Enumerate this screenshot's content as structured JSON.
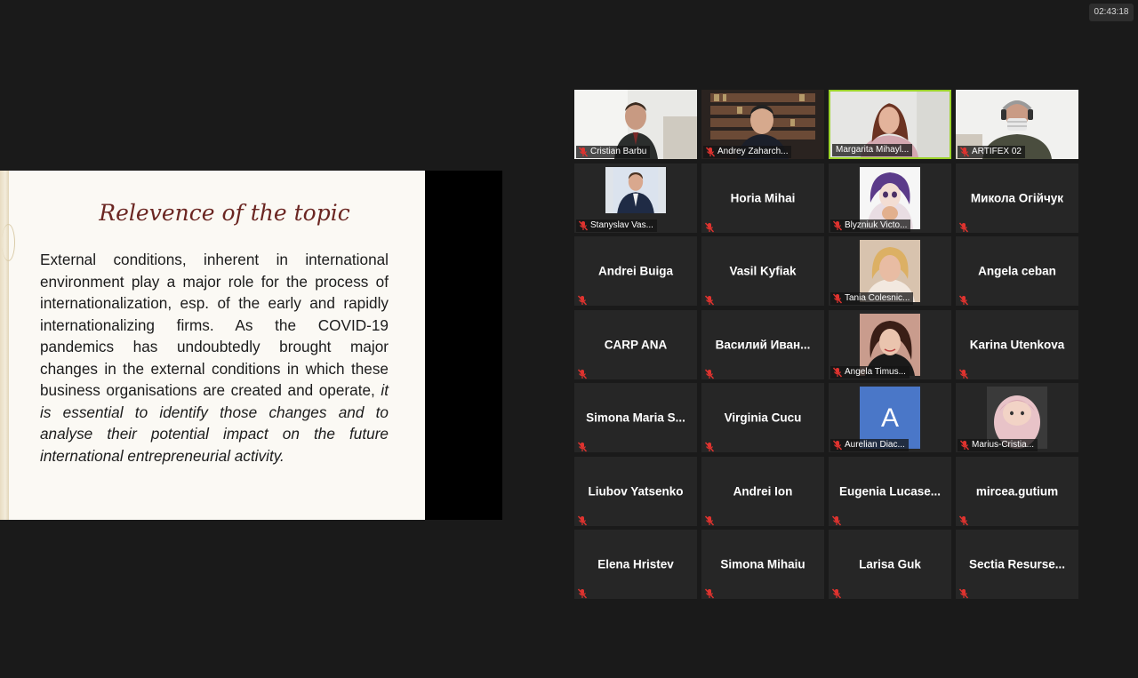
{
  "timer": "02:43:18",
  "slide": {
    "title": "Relevence of the topic",
    "body_plain": "External conditions, inherent in international environment play a major role for the process of internationalization, esp. of the early and rapidly internationalizing firms. As the COVID-19 pandemics has undoubtedly  brought major changes in the external conditions in which these business organisations are created and operate,",
    "body_italic": "it is essential to identify those changes and to analyse their potential impact on the future international entrepreneurial activity."
  },
  "participants": [
    {
      "name": "Cristian Barbu",
      "video": true,
      "muted": true,
      "active": false
    },
    {
      "name": "Andrey Zaharch...",
      "video": true,
      "muted": true,
      "active": false
    },
    {
      "name": "Margarita Mihayl...",
      "video": true,
      "muted": false,
      "active": true
    },
    {
      "name": "ARTIFEX 02",
      "video": true,
      "muted": true,
      "active": false
    },
    {
      "name": "Stanyslav Vas...",
      "video": true,
      "muted": true,
      "active": false
    },
    {
      "name": "Horia Mihai",
      "video": false,
      "muted": true,
      "active": false
    },
    {
      "name": "Blyzniuk Victo...",
      "video": true,
      "muted": true,
      "active": false
    },
    {
      "name": "Микола Огійчук",
      "video": false,
      "muted": true,
      "active": false
    },
    {
      "name": "Andrei Buiga",
      "video": false,
      "muted": true,
      "active": false
    },
    {
      "name": "Vasil Kyfiak",
      "video": false,
      "muted": true,
      "active": false
    },
    {
      "name": "Tania Colesnic...",
      "video": true,
      "muted": true,
      "active": false
    },
    {
      "name": "Angela ceban",
      "video": false,
      "muted": true,
      "active": false
    },
    {
      "name": "CARP ANA",
      "video": false,
      "muted": true,
      "active": false
    },
    {
      "name": "Василий  Иван...",
      "video": false,
      "muted": true,
      "active": false
    },
    {
      "name": "Angela Timus...",
      "video": true,
      "muted": true,
      "active": false
    },
    {
      "name": "Karina Utenkova",
      "video": false,
      "muted": true,
      "active": false
    },
    {
      "name": "Simona Maria S...",
      "video": false,
      "muted": true,
      "active": false
    },
    {
      "name": "Virginia Cucu",
      "video": false,
      "muted": true,
      "active": false
    },
    {
      "name": "Aurelian Diac...",
      "video": true,
      "muted": true,
      "active": false,
      "avatar_letter": "A"
    },
    {
      "name": "Marius-Cristia...",
      "video": true,
      "muted": true,
      "active": false
    },
    {
      "name": "Liubov Yatsenko",
      "video": false,
      "muted": true,
      "active": false
    },
    {
      "name": "Andrei Ion",
      "video": false,
      "muted": true,
      "active": false
    },
    {
      "name": "Eugenia  Lucase...",
      "video": false,
      "muted": true,
      "active": false
    },
    {
      "name": "mircea.gutium",
      "video": false,
      "muted": true,
      "active": false
    },
    {
      "name": "Elena Hristev",
      "video": false,
      "muted": true,
      "active": false
    },
    {
      "name": "Simona Mihaiu",
      "video": false,
      "muted": true,
      "active": false
    },
    {
      "name": "Larisa Guk",
      "video": false,
      "muted": true,
      "active": false
    },
    {
      "name": "Sectia  Resurse...",
      "video": false,
      "muted": true,
      "active": false
    }
  ],
  "colors": {
    "background": "#1a1a1a",
    "tile": "#262626",
    "active_speaker": "#9cd32a",
    "muted_icon": "#e0332f",
    "slide_title": "#6b2622"
  },
  "icons": {
    "muted": "mic-muted-icon"
  }
}
